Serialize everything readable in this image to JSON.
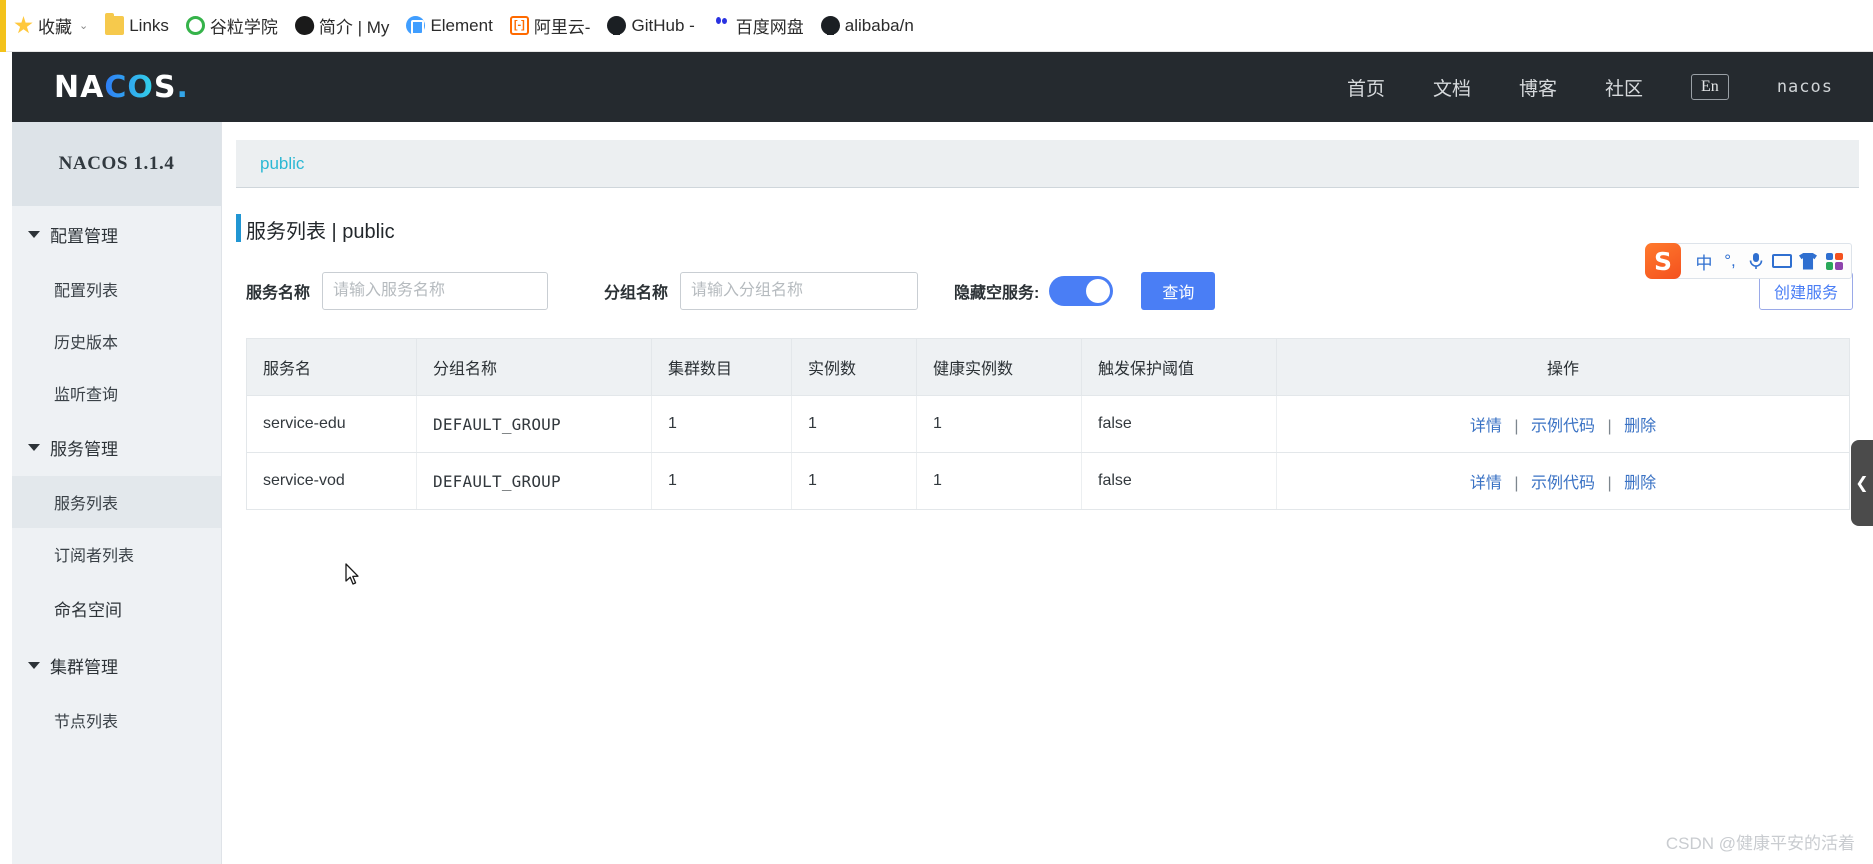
{
  "browser": {
    "bookmarks": [
      {
        "label": "收藏",
        "icon": "star-icon",
        "has_chevron": true
      },
      {
        "label": "Links",
        "icon": "folder-icon",
        "has_chevron": false
      },
      {
        "label": "谷粒学院",
        "icon": "green-circle-icon",
        "has_chevron": false
      },
      {
        "label": "简介 | My",
        "icon": "bird-icon",
        "has_chevron": false
      },
      {
        "label": "Element",
        "icon": "element-icon",
        "has_chevron": false
      },
      {
        "label": "阿里云-",
        "icon": "aliyun-icon",
        "has_chevron": false
      },
      {
        "label": "GitHub -",
        "icon": "github-icon",
        "has_chevron": false
      },
      {
        "label": "百度网盘",
        "icon": "baidu-icon",
        "has_chevron": false
      },
      {
        "label": "alibaba/n",
        "icon": "github-icon",
        "has_chevron": false
      }
    ]
  },
  "header": {
    "logo_part1": "NA",
    "logo_part2": "CO",
    "logo_part3": "S",
    "logo_dot": ".",
    "nav": [
      {
        "label": "首页"
      },
      {
        "label": "文档"
      },
      {
        "label": "博客"
      },
      {
        "label": "社区"
      }
    ],
    "lang_button": "En",
    "user": "nacos"
  },
  "sidebar": {
    "version": "NACOS 1.1.4",
    "groups": [
      {
        "label": "配置管理",
        "expanded": true,
        "items": [
          {
            "label": "配置列表",
            "active": false
          },
          {
            "label": "历史版本",
            "active": false
          },
          {
            "label": "监听查询",
            "active": false
          }
        ]
      },
      {
        "label": "服务管理",
        "expanded": true,
        "items": [
          {
            "label": "服务列表",
            "active": true
          },
          {
            "label": "订阅者列表",
            "active": false
          }
        ]
      }
    ],
    "namespace_item": {
      "label": "命名空间"
    },
    "cluster_group": {
      "label": "集群管理",
      "expanded": true,
      "items": [
        {
          "label": "节点列表",
          "active": false
        }
      ]
    }
  },
  "main": {
    "namespace_tab": "public",
    "page_title": "服务列表  |  public",
    "filters": {
      "service_name_label": "服务名称",
      "service_name_value": "",
      "service_name_placeholder": "请输入服务名称",
      "group_name_label": "分组名称",
      "group_name_value": "",
      "group_name_placeholder": "请输入分组名称",
      "hide_empty_label": "隐藏空服务:",
      "hide_empty_on": true,
      "query_button": "查询",
      "create_button": "创建服务"
    },
    "table": {
      "columns": [
        "服务名",
        "分组名称",
        "集群数目",
        "实例数",
        "健康实例数",
        "触发保护阈值",
        "操作"
      ],
      "rows": [
        {
          "service_name": "service-edu",
          "group_name": "DEFAULT_GROUP",
          "cluster_count": "1",
          "instance_count": "1",
          "healthy_count": "1",
          "protect_threshold": "false",
          "actions": [
            "详情",
            "示例代码",
            "删除"
          ]
        },
        {
          "service_name": "service-vod",
          "group_name": "DEFAULT_GROUP",
          "cluster_count": "1",
          "instance_count": "1",
          "healthy_count": "1",
          "protect_threshold": "false",
          "actions": [
            "详情",
            "示例代码",
            "删除"
          ]
        }
      ],
      "action_separator": "|"
    }
  },
  "ime_toolbar": {
    "logo": "S",
    "mode": "中",
    "punctuation": "°,",
    "icons": [
      "microphone-icon",
      "keyboard-icon",
      "skin-icon",
      "toolbox-icon"
    ]
  },
  "collapse_handle": {
    "glyph": "❮"
  },
  "watermark": "CSDN @健康平安的活着",
  "colors": {
    "header_bg": "#252a2f",
    "accent_blue": "#4a7ef5",
    "tab_cyan": "#2bb8d4",
    "link_blue": "#3a72c4",
    "sidebar_bg": "#eef1f4"
  }
}
